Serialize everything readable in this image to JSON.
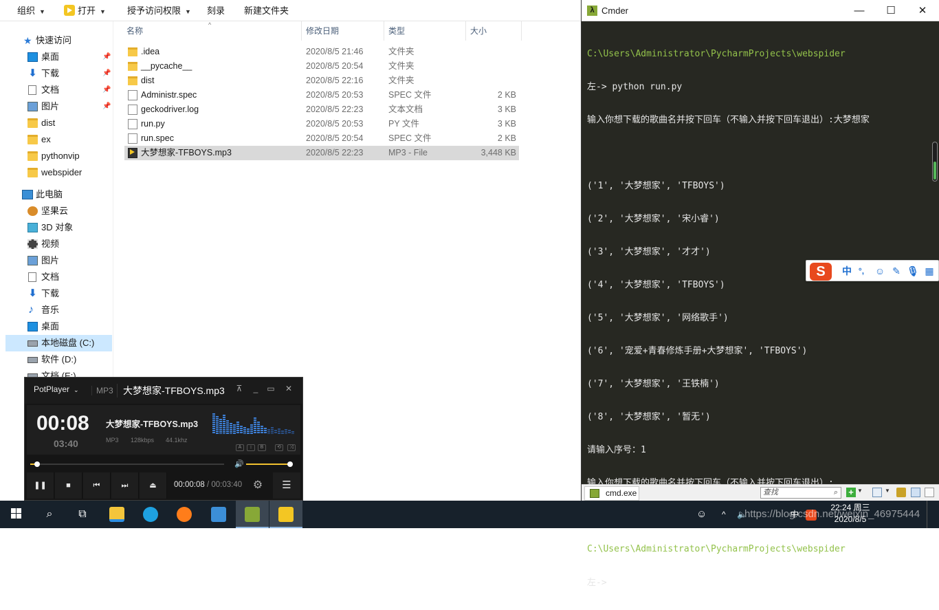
{
  "explorer": {
    "ribbon": {
      "organize": "组织",
      "open": "打开",
      "grant_access": "授予访问权限",
      "burn": "刻录",
      "new_folder": "新建文件夹"
    },
    "nav": {
      "quick_access": "快速访问",
      "desktop": "桌面",
      "downloads": "下载",
      "documents": "文档",
      "pictures": "图片",
      "dist": "dist",
      "ex": "ex",
      "pythonvip": "pythonvip",
      "webspider": "webspider",
      "this_pc": "此电脑",
      "jianguoyun": "坚果云",
      "objects3d": "3D 对象",
      "videos": "视频",
      "pictures2": "图片",
      "documents2": "文档",
      "downloads2": "下载",
      "music": "音乐",
      "desktop2": "桌面",
      "drive_c": "本地磁盘 (C:)",
      "drive_d": "软件 (D:)",
      "drive_e": "文档 (E:)"
    },
    "columns": {
      "name": "名称",
      "date": "修改日期",
      "type": "类型",
      "size": "大小"
    },
    "files": [
      {
        "name": ".idea",
        "date": "2020/8/5 21:46",
        "type": "文件夹",
        "size": ""
      },
      {
        "name": "__pycache__",
        "date": "2020/8/5 20:54",
        "type": "文件夹",
        "size": ""
      },
      {
        "name": "dist",
        "date": "2020/8/5 22:16",
        "type": "文件夹",
        "size": ""
      },
      {
        "name": "Administr.spec",
        "date": "2020/8/5 20:53",
        "type": "SPEC 文件",
        "size": "2 KB"
      },
      {
        "name": "geckodriver.log",
        "date": "2020/8/5 22:23",
        "type": "文本文档",
        "size": "3 KB"
      },
      {
        "name": "run.py",
        "date": "2020/8/5 20:53",
        "type": "PY 文件",
        "size": "3 KB"
      },
      {
        "name": "run.spec",
        "date": "2020/8/5 20:54",
        "type": "SPEC 文件",
        "size": "2 KB"
      },
      {
        "name": "大梦想家-TFBOYS.mp3",
        "date": "2020/8/5 22:23",
        "type": "MP3 - File",
        "size": "3,448 KB"
      }
    ]
  },
  "cmder": {
    "title": "Cmder",
    "lines": [
      "C:\\Users\\Administrator\\PycharmProjects\\webspider",
      "左-> python run.py",
      "输入你想下载的歌曲名并按下回车（不输入并按下回车退出）:大梦想家",
      "",
      "('1', '大梦想家', 'TFBOYS')",
      "('2', '大梦想家', '宋小睿')",
      "('3', '大梦想家', '才才')",
      "('4', '大梦想家', 'TFBOYS')",
      "('5', '大梦想家', '网络歌手')",
      "('6', '宠爱+青春修炼手册+大梦想家', 'TFBOYS')",
      "('7', '大梦想家', '王铁楠')",
      "('8', '大梦想家', '暂无')",
      "请输入序号：1",
      "输入你想下载的歌曲名并按下回车（不输入并按下回车退出）:",
      "",
      "C:\\Users\\Administrator\\PycharmProjects\\webspider",
      "左-> "
    ],
    "tab": "cmd.exe",
    "find_placeholder": "查找",
    "ime": {
      "lang": "中",
      "punct": "°,"
    }
  },
  "potplayer": {
    "brand": "PotPlayer",
    "format": "MP3",
    "title": "大梦想家-TFBOYS.mp3",
    "time": "00:08",
    "total": "03:40",
    "track": "大梦想家-TFBOYS.mp3",
    "codec": "MP3",
    "bitrate": "128kbps",
    "samplerate": "44.1khz",
    "position": "00:00:08",
    "separator": "/",
    "duration": "00:03:40",
    "progress": 0.036,
    "volume": 0.97,
    "mini_buttons": [
      "A",
      "↕",
      "B"
    ]
  },
  "taskbar": {
    "clock_time": "22:24 周三",
    "clock_date": "2020/8/5",
    "tray_lang": "中",
    "watermark": "https://blog.csdn.net/weixin_46975444"
  }
}
